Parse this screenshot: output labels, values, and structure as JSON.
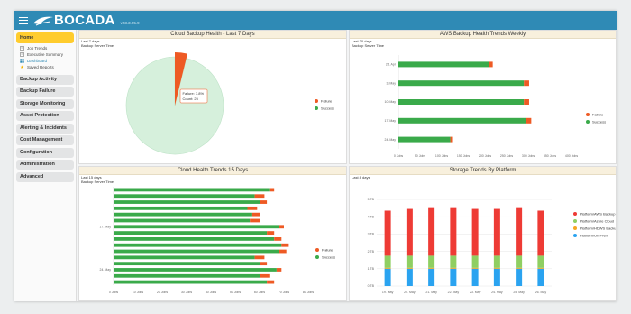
{
  "app": {
    "brand": "BOCADA",
    "version": "v23.3.95.9"
  },
  "sidebar": {
    "home": "Home",
    "subitems": [
      {
        "label": "Job Trends",
        "icon": "doc-icon"
      },
      {
        "label": "Executive Summary",
        "icon": "doc-icon"
      },
      {
        "label": "Dashboard",
        "icon": "grid-icon"
      },
      {
        "label": "Saved Reports",
        "icon": "star-icon"
      }
    ],
    "sections": [
      "Backup Activity",
      "Backup Failure",
      "Storage Monitoring",
      "Asset Protection",
      "Alerting & Incidents",
      "Cost Management",
      "Configuration",
      "Administration",
      "Advanced"
    ]
  },
  "panels": {
    "p1": {
      "title": "Cloud Backup Health - Last 7 Days",
      "period": "Last 7 days",
      "tz": "Backup Server Time"
    },
    "p2": {
      "title": "AWS Backup Health Trends Weekly",
      "period": "Last 30 days",
      "tz": "Backup Server Time"
    },
    "p3": {
      "title": "Cloud Health Trends 15 Days",
      "period": "Last 15 days",
      "tz": "Backup Server Time"
    },
    "p4": {
      "title": "Storage Trends By Platform",
      "period": "Last 8 days"
    }
  },
  "legend": {
    "failure": "Failure",
    "success": "Success"
  },
  "colors": {
    "success": "#3aaa4a",
    "failure": "#ee5a24",
    "pie_success": "#d6f0dc",
    "aws": "#ee3b35",
    "azure": "#8fcf62",
    "hdws": "#f5a623",
    "onprem": "#2aa3f0"
  },
  "chart_data": [
    {
      "type": "pie",
      "title": "Cloud Backup Health - Last 7 Days",
      "slices": [
        {
          "name": "Failure",
          "percent": 3.8,
          "count": 25
        },
        {
          "name": "Success",
          "percent": 96.2
        }
      ],
      "tooltip": {
        "line1": "Failure: 3.8%",
        "line2": "Count: 25"
      }
    },
    {
      "type": "bar",
      "title": "AWS Backup Health Trends Weekly",
      "orientation": "horizontal",
      "categories": [
        "26. Apr",
        "3. May",
        "10. May",
        "17. May",
        "24. May"
      ],
      "series": [
        {
          "name": "Success",
          "values": [
            210,
            290,
            290,
            295,
            120
          ]
        },
        {
          "name": "Failure",
          "values": [
            8,
            12,
            12,
            12,
            4
          ]
        }
      ],
      "xticks": [
        "0 Jobs",
        "50 Jobs",
        "100 Jobs",
        "150 Jobs",
        "200 Jobs",
        "250 Jobs",
        "300 Jobs",
        "350 Jobs",
        "400 Jobs"
      ],
      "xlim": [
        0,
        400
      ]
    },
    {
      "type": "bar",
      "title": "Cloud Health Trends 15 Days",
      "orientation": "horizontal",
      "labeled_rows": {
        "17. May": 6,
        "24. May": 13
      },
      "series": [
        {
          "name": "Success",
          "values": [
            64,
            58,
            60,
            55,
            57,
            56,
            68,
            63,
            66,
            69,
            68,
            58,
            60,
            67,
            60,
            63
          ]
        },
        {
          "name": "Failure",
          "values": [
            2,
            4,
            3,
            4,
            3,
            4,
            2,
            3,
            3,
            3,
            3,
            4,
            3,
            2,
            4,
            3
          ]
        }
      ],
      "xticks": [
        "0 Jobs",
        "10 Jobs",
        "20 Jobs",
        "30 Jobs",
        "40 Jobs",
        "50 Jobs",
        "60 Jobs",
        "70 Jobs",
        "80 Jobs"
      ],
      "xlim": [
        0,
        80
      ]
    },
    {
      "type": "bar",
      "title": "Storage Trends By Platform",
      "stacked": true,
      "categories": [
        "19. May",
        "20. May",
        "21. May",
        "22. May",
        "23. May",
        "24. May",
        "25. May",
        "26. May"
      ],
      "series": [
        {
          "name": "Platform/AWS Backup",
          "values": [
            2.6,
            2.7,
            2.8,
            2.8,
            2.7,
            2.7,
            2.8,
            2.6
          ]
        },
        {
          "name": "Platform/Azure Cloud",
          "values": [
            0.7,
            0.7,
            0.7,
            0.7,
            0.7,
            0.7,
            0.7,
            0.7
          ]
        },
        {
          "name": "Platform/HDWS Backup",
          "values": [
            0.05,
            0.05,
            0.05,
            0.05,
            0.05,
            0.05,
            0.05,
            0.05
          ]
        },
        {
          "name": "Platform/On Prem",
          "values": [
            1.0,
            1.0,
            1.0,
            1.0,
            1.0,
            1.0,
            1.0,
            1.0
          ]
        }
      ],
      "yticks": [
        "0 TB",
        "1 TB",
        "2 TB",
        "3 TB",
        "4 TB",
        "5 TB"
      ],
      "ylim": [
        0,
        5
      ]
    }
  ]
}
